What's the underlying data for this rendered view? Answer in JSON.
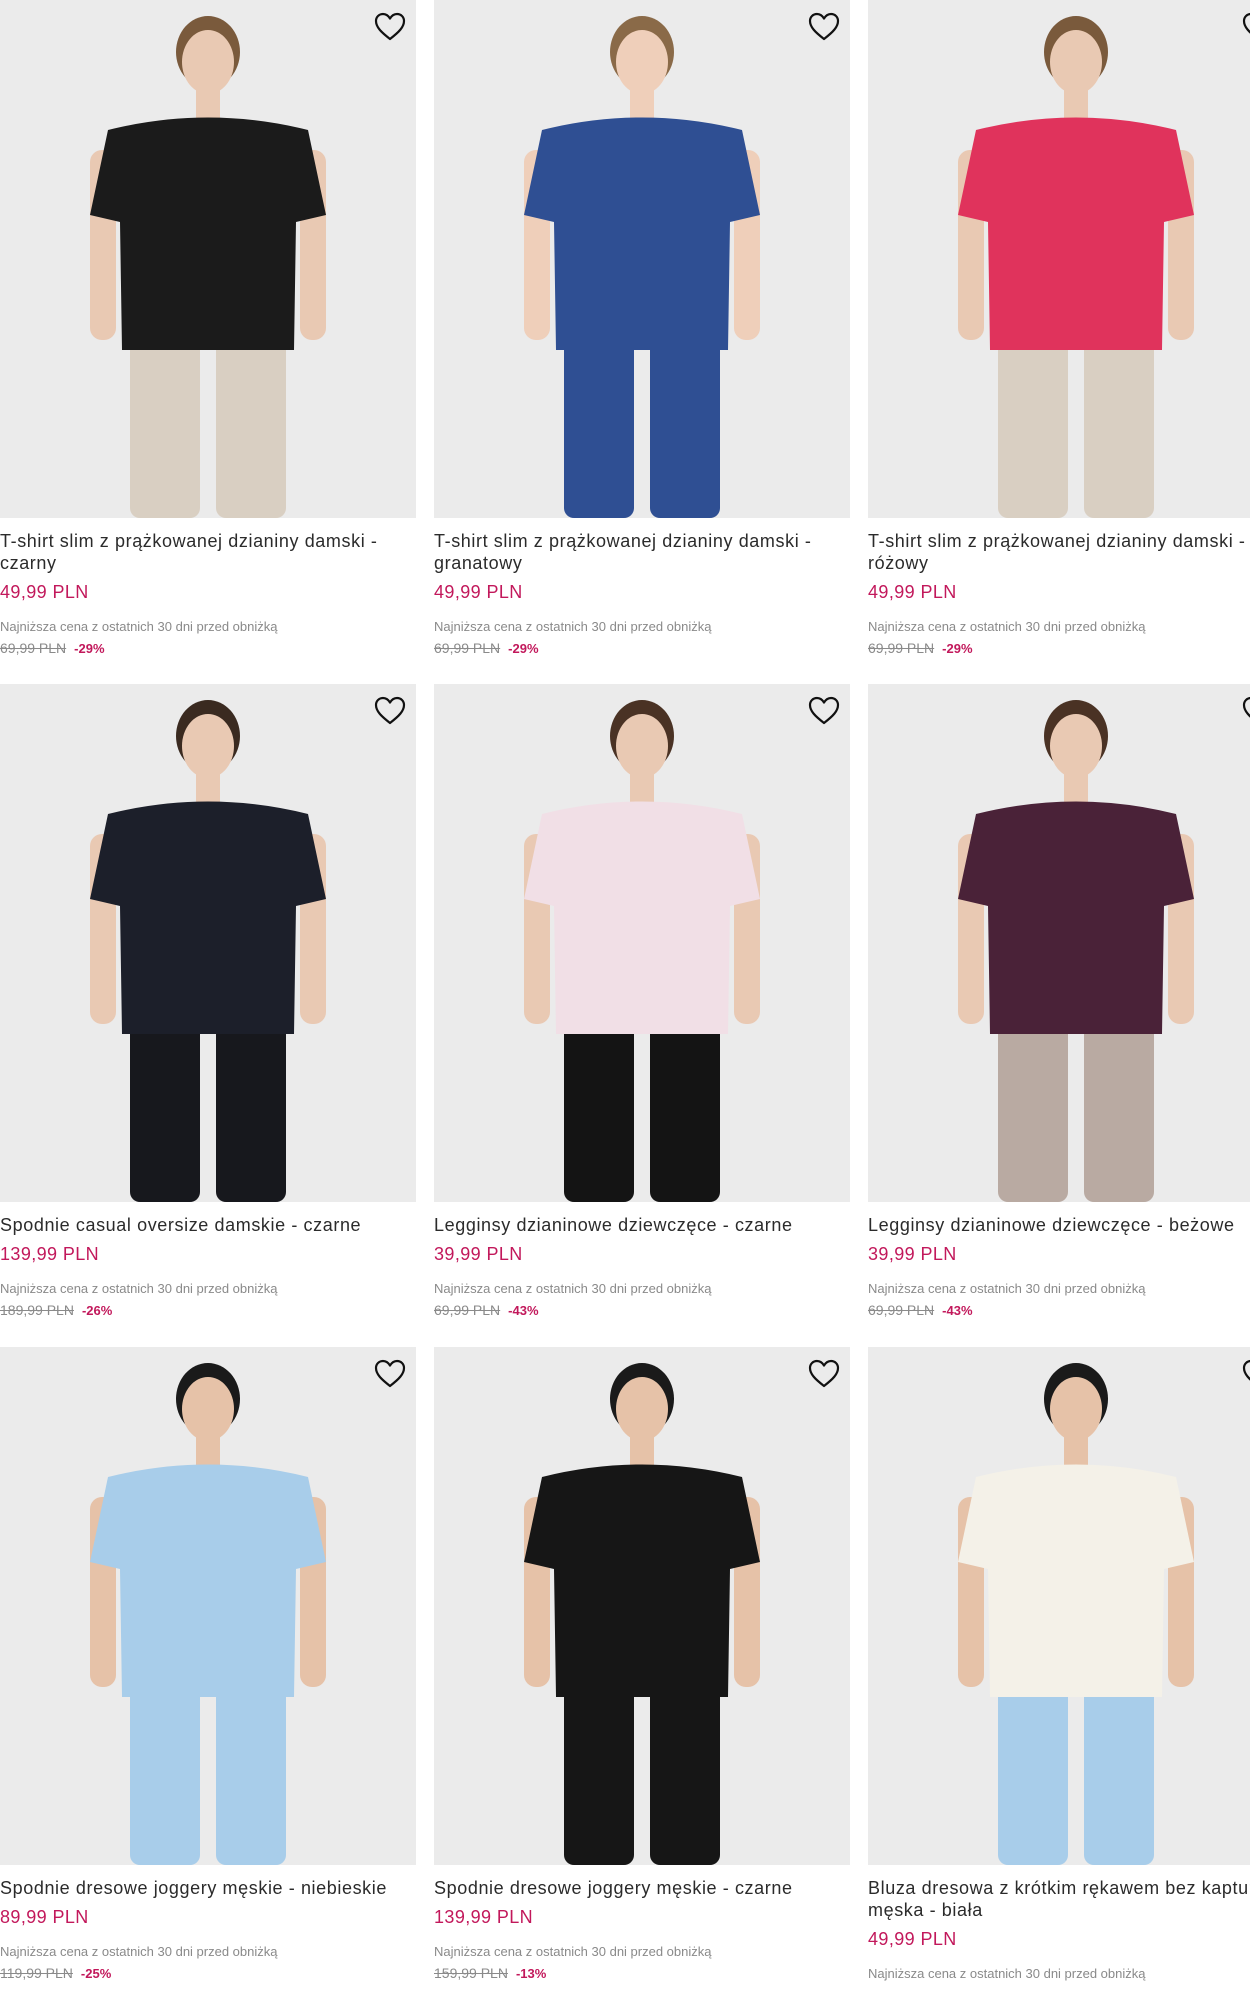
{
  "lowest_price_note": "Najniższa cena z ostatnich 30 dni przed obniżką",
  "accent_color": "#c2185b",
  "products": [
    {
      "title": "T-shirt slim z prążkowanej dzianiny damski - czarny",
      "price": "49,99 PLN",
      "old_price": "69,99 PLN",
      "discount": "-29%",
      "top_color": "#1b1b1b",
      "bottom_color": "#d9cfc2",
      "skin": "#e9c9b3",
      "hair": "#7a5a3c"
    },
    {
      "title": "T-shirt slim z prążkowanej dzianiny damski - granatowy",
      "price": "49,99 PLN",
      "old_price": "69,99 PLN",
      "discount": "-29%",
      "top_color": "#2f4f93",
      "bottom_color": "#2f4f93",
      "skin": "#efcfba",
      "hair": "#8a6a48"
    },
    {
      "title": "T-shirt slim z prążkowanej dzianiny damski - różowy",
      "price": "49,99 PLN",
      "old_price": "69,99 PLN",
      "discount": "-29%",
      "top_color": "#e0335c",
      "bottom_color": "#d9cfc2",
      "skin": "#e9c9b3",
      "hair": "#7a5a3c"
    },
    {
      "title": "Spodnie casual oversize damskie - czarne",
      "price": "139,99 PLN",
      "old_price": "189,99 PLN",
      "discount": "-26%",
      "top_color": "#1c1f2a",
      "bottom_color": "#17181d",
      "skin": "#e9c9b3",
      "hair": "#3a2a20"
    },
    {
      "title": "Legginsy dzianinowe dziewczęce - czarne",
      "price": "39,99 PLN",
      "old_price": "69,99 PLN",
      "discount": "-43%",
      "top_color": "#f1dfe6",
      "bottom_color": "#141414",
      "skin": "#e9c9b3",
      "hair": "#4a3224"
    },
    {
      "title": "Legginsy dzianinowe dziewczęce - beżowe",
      "price": "39,99 PLN",
      "old_price": "69,99 PLN",
      "discount": "-43%",
      "top_color": "#4a2238",
      "bottom_color": "#b9aaa2",
      "skin": "#e9c9b3",
      "hair": "#4a3224"
    },
    {
      "title": "Spodnie dresowe joggery męskie - niebieskie",
      "price": "89,99 PLN",
      "old_price": "119,99 PLN",
      "discount": "-25%",
      "top_color": "#a8cdea",
      "bottom_color": "#a8cdea",
      "skin": "#e6c2a8",
      "hair": "#1a1a1a"
    },
    {
      "title": "Spodnie dresowe joggery męskie - czarne",
      "price": "139,99 PLN",
      "old_price": "159,99 PLN",
      "discount": "-13%",
      "top_color": "#161616",
      "bottom_color": "#161616",
      "skin": "#e6c2a8",
      "hair": "#1a1a1a"
    },
    {
      "title": "Bluza dresowa z krótkim rękawem bez kaptura męska - biała",
      "price": "49,99 PLN",
      "old_price": "",
      "discount": "",
      "top_color": "#f4f1e8",
      "bottom_color": "#a8cdea",
      "skin": "#e6c2a8",
      "hair": "#1a1a1a"
    }
  ]
}
